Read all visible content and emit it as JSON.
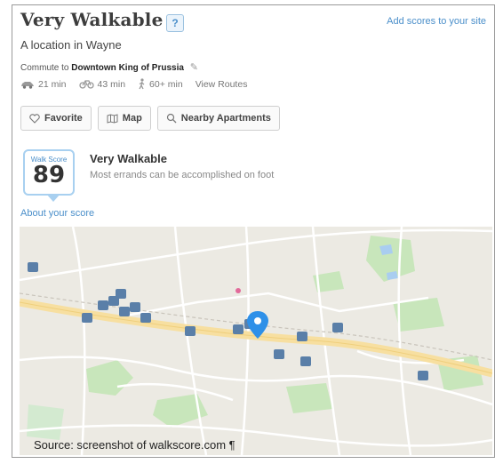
{
  "header": {
    "title": "Very Walkable",
    "help_label": "?",
    "add_scores_link": "Add scores to your site",
    "location": "A location in Wayne"
  },
  "commute": {
    "prefix": "Commute to",
    "destination": "Downtown King of Prussia",
    "modes": [
      {
        "icon": "car-icon",
        "time": "21 min"
      },
      {
        "icon": "bike-icon",
        "time": "43 min"
      },
      {
        "icon": "walk-icon",
        "time": "60+ min"
      }
    ],
    "view_routes": "View Routes"
  },
  "actions": {
    "favorite": "Favorite",
    "map": "Map",
    "nearby": "Nearby Apartments"
  },
  "score": {
    "badge_label": "Walk Score",
    "value": "89",
    "title": "Very Walkable",
    "description": "Most errands can be accomplished on foot",
    "about_link": "About your score"
  },
  "caption": "Source: screenshot of walkscore.com ¶",
  "colors": {
    "link": "#4b8fca",
    "map_road": "#f7dfa0",
    "map_park": "#c5e6b8",
    "pin": "#2e90e8",
    "poi": "#5a7fa8"
  }
}
